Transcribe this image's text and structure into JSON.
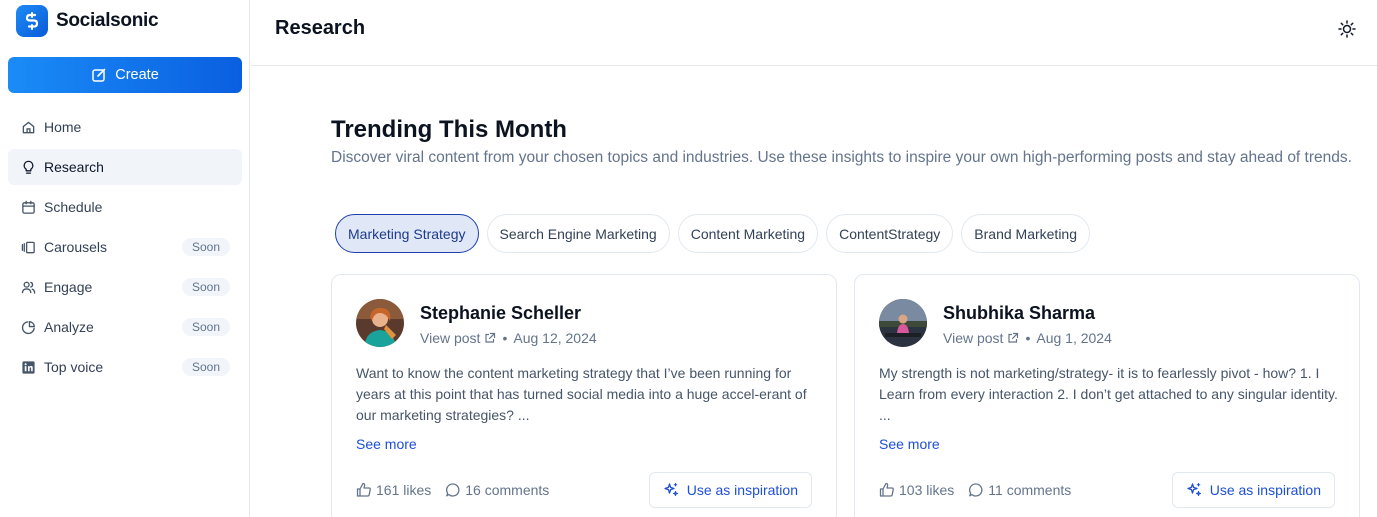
{
  "app": {
    "name": "Socialsonic",
    "logo_icon": "socialsonic-logo-icon",
    "accent": "#1a8cf7"
  },
  "sidebar": {
    "create_label": "Create",
    "items": [
      {
        "label": "Home",
        "icon": "home-icon",
        "badge": ""
      },
      {
        "label": "Research",
        "icon": "lightbulb-icon",
        "badge": "",
        "active": true
      },
      {
        "label": "Schedule",
        "icon": "calendar-icon",
        "badge": ""
      },
      {
        "label": "Carousels",
        "icon": "carousel-icon",
        "badge": "Soon"
      },
      {
        "label": "Engage",
        "icon": "users-icon",
        "badge": "Soon"
      },
      {
        "label": "Analyze",
        "icon": "pie-chart-icon",
        "badge": "Soon"
      },
      {
        "label": "Top voice",
        "icon": "linkedin-icon",
        "badge": "Soon"
      }
    ]
  },
  "header": {
    "title": "Research",
    "theme_icon": "sun-icon"
  },
  "main": {
    "title": "Trending This Month",
    "subtitle": "Discover viral content from your chosen topics and industries. Use these insights to inspire your own high-performing posts and stay ahead of trends.",
    "chips": [
      {
        "label": "Marketing Strategy",
        "active": true
      },
      {
        "label": "Search Engine Marketing"
      },
      {
        "label": "Content Marketing"
      },
      {
        "label": "ContentStrategy"
      },
      {
        "label": "Brand Marketing"
      }
    ],
    "posts": [
      {
        "author": "Stephanie Scheller",
        "view_label": "View post",
        "date": "Aug 12, 2024",
        "text": "Want to know the content marketing strategy that I’ve been running for years at this point that has turned social media into a huge accel-erant of our marketing strategies? ...",
        "see_more": "See more",
        "likes": "161 likes",
        "comments": "16 comments",
        "cta": "Use as inspiration"
      },
      {
        "author": "Shubhika Sharma",
        "view_label": "View post",
        "date": "Aug 1, 2024",
        "text": "My strength is not marketing/strategy- it is to fearlessly pivot - how? 1. I Learn from every interaction 2. I don’t get attached to any singular identity. ...",
        "see_more": "See more",
        "likes": "103 likes",
        "comments": "11 comments",
        "cta": "Use as inspiration"
      }
    ]
  }
}
